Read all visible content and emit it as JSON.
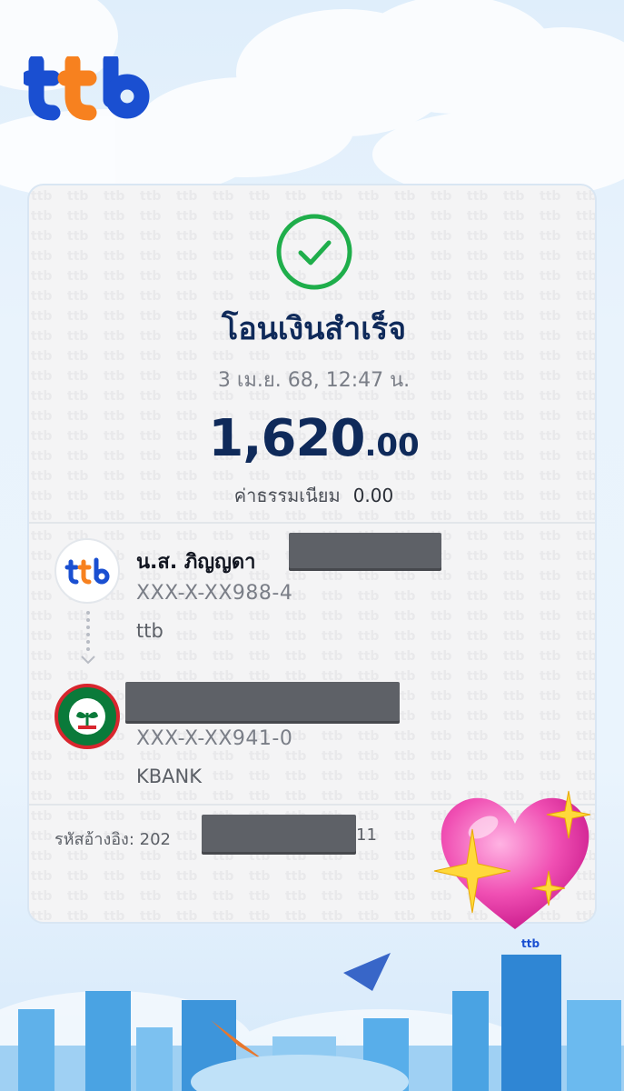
{
  "brand": {
    "logo_text": "ttb"
  },
  "receipt": {
    "status_title": "โอนเงินสำเร็จ",
    "datetime": "3 เม.ย. 68, 12:47 น.",
    "amount_main": "1,620",
    "amount_decimal": ".00",
    "fee_label": "ค่าธรรมเนียม",
    "fee_value": "0.00"
  },
  "sender": {
    "name": "น.ส. ภิญญดา",
    "account": "XXX-X-XX988-4",
    "bank": "ttb",
    "logo_text": "ttb"
  },
  "recipient": {
    "account": "XXX-X-XX941-0",
    "bank": "KBANK"
  },
  "reference": {
    "label": "รหัสอ้างอิง: 202",
    "tail": "11"
  },
  "decor": {
    "city_logo_text": "ttb"
  },
  "colors": {
    "brand_blue": "#1a4fd1",
    "brand_orange": "#f7811f",
    "success_green": "#1fae4b",
    "title_navy": "#0f2a5a"
  },
  "icons": [
    "success-check-icon",
    "arrow-down-icon",
    "heart-sparkle-sticker"
  ]
}
